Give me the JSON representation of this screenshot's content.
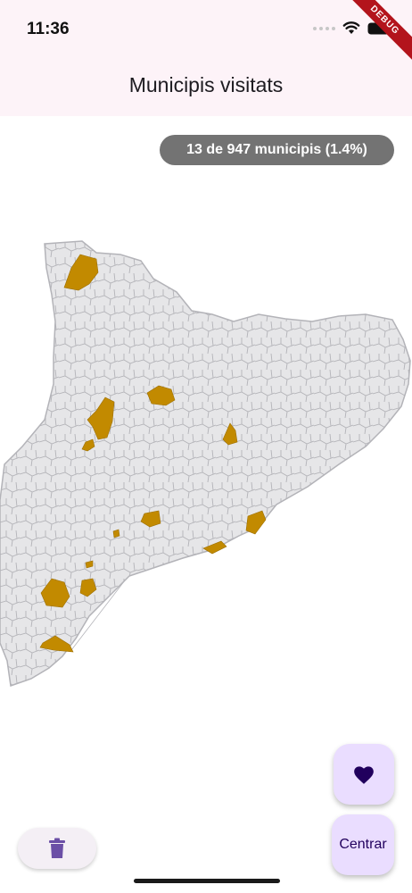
{
  "status_bar": {
    "time": "11:36"
  },
  "debug_banner": "DEBUG",
  "app_bar": {
    "title": "Municipis visitats"
  },
  "summary": {
    "label": "13 de 947 municipis (1.4%)"
  },
  "actions": {
    "center_label": "Centrar"
  },
  "colors": {
    "visited": "#c28a00",
    "unvisited": "#e6e6e8",
    "border": "#b3b3b8",
    "fab": "#eaddff",
    "icon": "#21005d",
    "trash": "#6b4fa6"
  },
  "icons": [
    "wifi-icon",
    "battery-icon",
    "heart-icon",
    "trash-icon"
  ]
}
